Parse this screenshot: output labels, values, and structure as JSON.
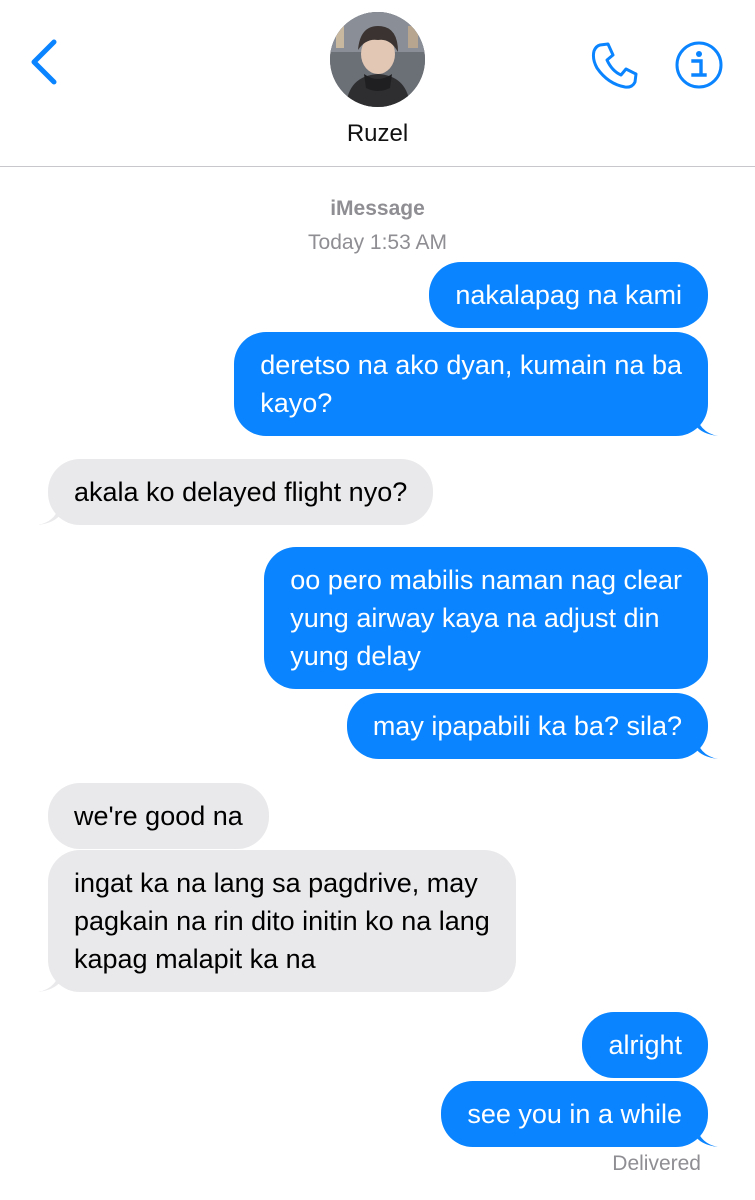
{
  "header": {
    "contact_name": "Ruzel",
    "back_icon": "chevron-left-icon",
    "call_icon": "phone-icon",
    "info_icon": "info-icon",
    "accent_color": "#0a84ff"
  },
  "thread": {
    "service": "iMessage",
    "timestamp": "Today 1:53 AM",
    "messages": [
      {
        "from": "me",
        "lines": [
          "nakalapag na kami"
        ]
      },
      {
        "from": "me",
        "lines": [
          "deretso na ako dyan, kumain na ba",
          "kayo?"
        ]
      },
      {
        "from": "them",
        "lines": [
          "akala ko delayed flight nyo?"
        ]
      },
      {
        "from": "me",
        "lines": [
          "oo pero mabilis naman nag clear",
          "yung airway kaya na adjust din",
          "yung delay"
        ]
      },
      {
        "from": "me",
        "lines": [
          "may ipapabili ka ba? sila?"
        ]
      },
      {
        "from": "them",
        "lines": [
          "we're good na"
        ]
      },
      {
        "from": "them",
        "lines": [
          "ingat ka na lang sa pagdrive, may",
          "pagkain na rin dito initin ko na lang",
          "kapag malapit ka na"
        ]
      },
      {
        "from": "me",
        "lines": [
          "alright"
        ]
      },
      {
        "from": "me",
        "lines": [
          "see you in a while"
        ]
      }
    ],
    "status": "Delivered"
  },
  "colors": {
    "sent_bubble": "#0a84ff",
    "received_bubble": "#e9e9eb",
    "meta_text": "#8e8e93"
  }
}
